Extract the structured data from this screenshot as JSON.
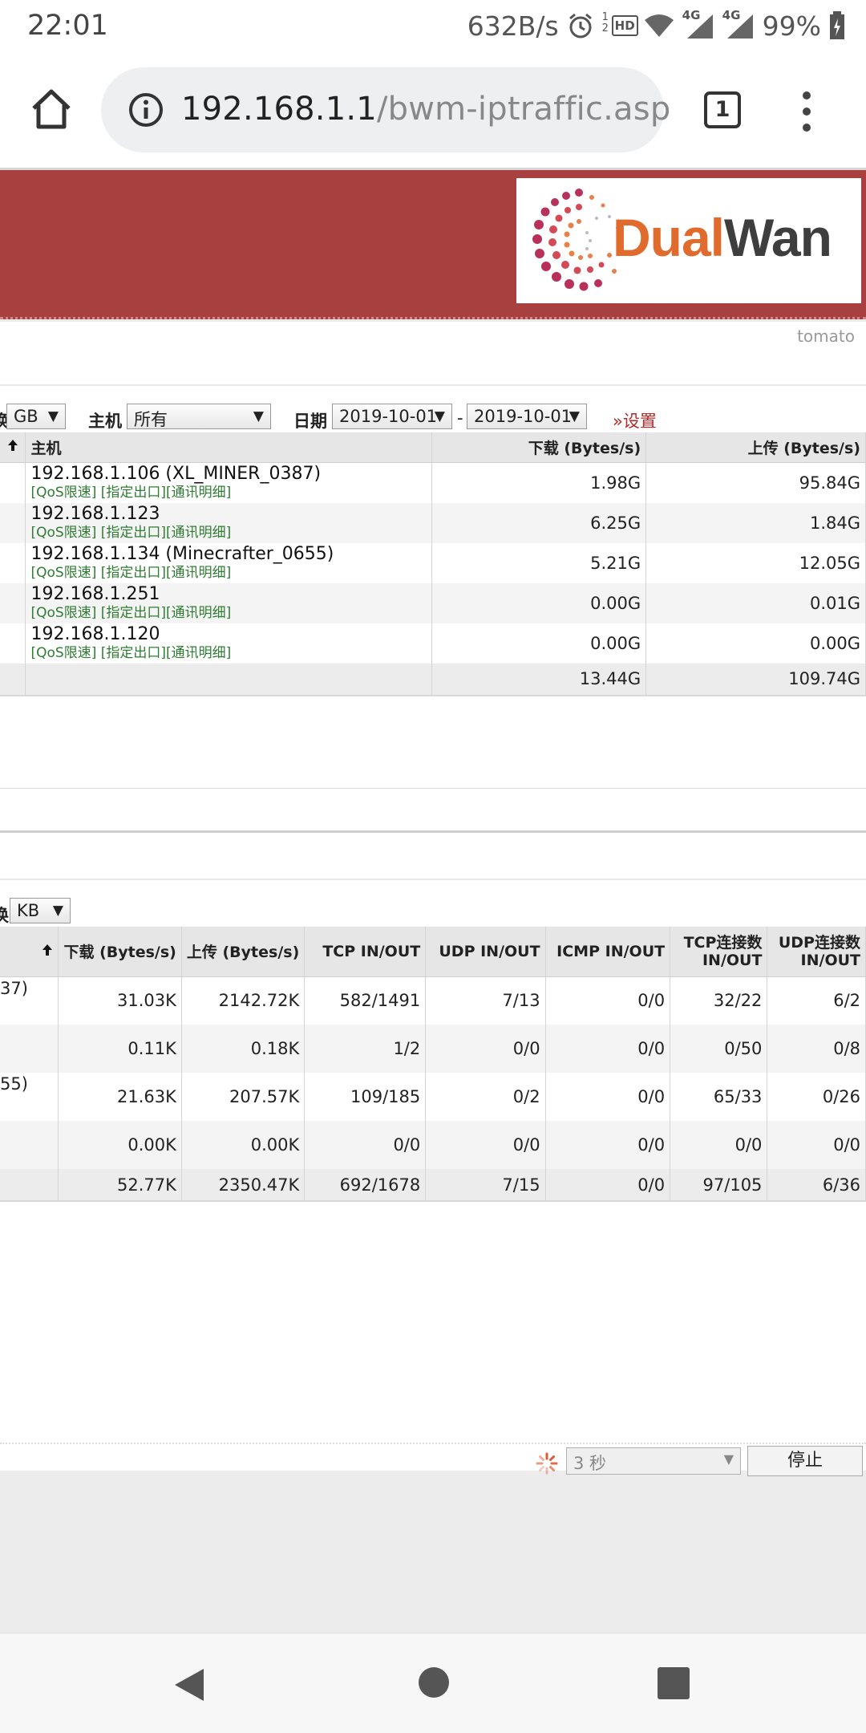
{
  "status_bar": {
    "time": "22:01",
    "net_speed": "632B/s",
    "hd_label": "HD",
    "sim_label": "4G",
    "battery": "99%"
  },
  "browser": {
    "url_host": "192.168.1.1",
    "url_path": "/bwm-iptraffic.asp",
    "tab_count": "1"
  },
  "site": {
    "logo_part1": "Dual",
    "logo_part2": "Wan",
    "brand": "tomato"
  },
  "filters": {
    "unit_cut": "换",
    "unit_value": "GB",
    "host_label": "主机",
    "host_value": "所有",
    "date_label": "日期",
    "date_from": "2019-10-01",
    "date_sep": "-",
    "date_to": "2019-10-01",
    "settings_link": "»设置"
  },
  "traffic_table": {
    "headers": {
      "host": "主机",
      "download": "下载 (Bytes/s)",
      "upload": "上传 (Bytes/s)"
    },
    "link_qos": "[QoS限速]",
    "link_exit": "[指定出口]",
    "link_detail": "[通讯明细]",
    "rows": [
      {
        "host": "192.168.1.106 (XL_MINER_0387)",
        "down": "1.98G",
        "up": "95.84G"
      },
      {
        "host": "192.168.1.123",
        "down": "6.25G",
        "up": "1.84G"
      },
      {
        "host": "192.168.1.134 (Minecrafter_0655)",
        "down": "5.21G",
        "up": "12.05G"
      },
      {
        "host": "192.168.1.251",
        "down": "0.00G",
        "up": "0.01G"
      },
      {
        "host": "192.168.1.120",
        "down": "0.00G",
        "up": "0.00G"
      }
    ],
    "total": {
      "down": "13.44G",
      "up": "109.74G"
    }
  },
  "realtime": {
    "unit_cut": "换",
    "unit_value": "KB",
    "headers": {
      "download": "下载 (Bytes/s)",
      "upload": "上传 (Bytes/s)",
      "tcp": "TCP IN/OUT",
      "udp": "UDP IN/OUT",
      "icmp": "ICMP IN/OUT",
      "tcp_conn_1": "TCP连接数",
      "tcp_conn_2": "IN/OUT",
      "udp_conn_1": "UDP连接数",
      "udp_conn_2": "IN/OUT"
    },
    "rows": [
      {
        "host": "37)",
        "down": "31.03K",
        "up": "2142.72K",
        "tcp": "582/1491",
        "udp": "7/13",
        "icmp": "0/0",
        "tcpc": "32/22",
        "udpc": "6/2"
      },
      {
        "host": "",
        "down": "0.11K",
        "up": "0.18K",
        "tcp": "1/2",
        "udp": "0/0",
        "icmp": "0/0",
        "tcpc": "0/50",
        "udpc": "0/8"
      },
      {
        "host": "55)",
        "down": "21.63K",
        "up": "207.57K",
        "tcp": "109/185",
        "udp": "0/2",
        "icmp": "0/0",
        "tcpc": "65/33",
        "udpc": "0/26"
      },
      {
        "host": "",
        "down": "0.00K",
        "up": "0.00K",
        "tcp": "0/0",
        "udp": "0/0",
        "icmp": "0/0",
        "tcpc": "0/0",
        "udpc": "0/0"
      }
    ],
    "total": {
      "down": "52.77K",
      "up": "2350.47K",
      "tcp": "692/1678",
      "udp": "7/15",
      "icmp": "0/0",
      "tcpc": "97/105",
      "udpc": "6/36"
    }
  },
  "refresh": {
    "interval": "3 秒",
    "stop": "停止"
  }
}
